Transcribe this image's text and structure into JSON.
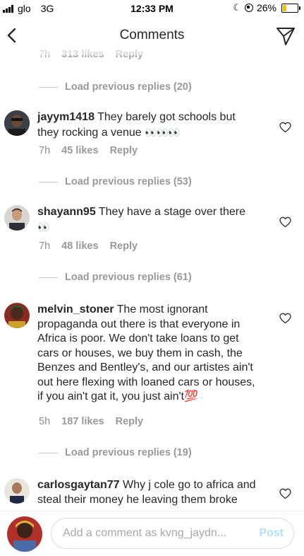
{
  "status_bar": {
    "carrier": "glo",
    "network": "3G",
    "time": "12:33 PM",
    "battery_percent": "26%",
    "battery_level": 0.26
  },
  "header": {
    "title": "Comments"
  },
  "partial_top_meta": {
    "time": "7h",
    "likes": "313 likes",
    "reply": "Reply"
  },
  "feed": [
    {
      "load_prev": "Load previous replies (20)"
    },
    {
      "username": "jayym1418",
      "text": "They barely got schools but they rocking a venue",
      "emoji": "👀👀👀",
      "time": "7h",
      "likes": "45 likes",
      "reply": "Reply"
    },
    {
      "load_prev": "Load previous replies (53)"
    },
    {
      "username": "shayann95",
      "text": "They have a stage over there",
      "emoji": "👀",
      "time": "7h",
      "likes": "48 likes",
      "reply": "Reply"
    },
    {
      "load_prev": "Load previous replies (61)"
    },
    {
      "username": "melvin_stoner",
      "text": "The most ignorant propaganda out there is that everyone in Africa is poor. We don't take loans to get cars or houses, we buy them in cash, the Benzes and Bentley's, and our artistes ain't out here flexing with loaned cars or houses, if you ain't gat it, you just ain't",
      "emoji": "💯",
      "time": "5h",
      "likes": "187 likes",
      "reply": "Reply"
    },
    {
      "load_prev": "Load previous replies (19)"
    },
    {
      "username": "carlosgaytan77",
      "text": "Why j cole go to africa and steal their money he leaving them broke",
      "emoji": ""
    }
  ],
  "composer": {
    "placeholder": "Add a comment as kvng_jaydn...",
    "post_label": "Post"
  },
  "colors": {
    "text": "#262626",
    "meta": "#8e8e8e",
    "post_disabled": "#b2dffc",
    "battery": "#f2c200"
  }
}
